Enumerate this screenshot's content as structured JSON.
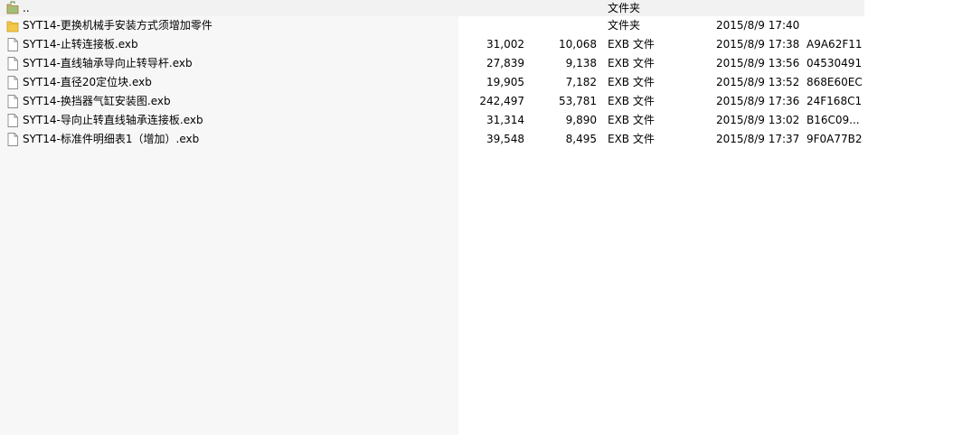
{
  "parent_row": {
    "name": "..",
    "type": "文件夹",
    "icon": "folder-up-icon"
  },
  "rows": [
    {
      "name": "SYT14-更换机械手安装方式须增加零件",
      "size": "",
      "packed": "",
      "type": "文件夹",
      "modified": "2015/8/9 17:40",
      "crc": "",
      "icon": "folder-icon"
    },
    {
      "name": "SYT14-止转连接板.exb",
      "size": "31,002",
      "packed": "10,068",
      "type": "EXB 文件",
      "modified": "2015/8/9 17:38",
      "crc": "A9A62F11",
      "icon": "file-icon"
    },
    {
      "name": "SYT14-直线轴承导向止转导杆.exb",
      "size": "27,839",
      "packed": "9,138",
      "type": "EXB 文件",
      "modified": "2015/8/9 13:56",
      "crc": "04530491",
      "icon": "file-icon"
    },
    {
      "name": "SYT14-直径20定位块.exb",
      "size": "19,905",
      "packed": "7,182",
      "type": "EXB 文件",
      "modified": "2015/8/9 13:52",
      "crc": "868E60EC",
      "icon": "file-icon"
    },
    {
      "name": "SYT14-换挡器气缸安装图.exb",
      "size": "242,497",
      "packed": "53,781",
      "type": "EXB 文件",
      "modified": "2015/8/9 17:36",
      "crc": "24F168C1",
      "icon": "file-icon"
    },
    {
      "name": "SYT14-导向止转直线轴承连接板.exb",
      "size": "31,314",
      "packed": "9,890",
      "type": "EXB 文件",
      "modified": "2015/8/9 13:02",
      "crc": "B16C09...",
      "icon": "file-icon"
    },
    {
      "name": "SYT14-标准件明细表1（增加）.exb",
      "size": "39,548",
      "packed": "8,495",
      "type": "EXB 文件",
      "modified": "2015/8/9 17:37",
      "crc": "9F0A77B2",
      "icon": "file-icon"
    }
  ],
  "colors": {
    "name_column_bg": "#f7f7f7",
    "top_row_bg": "#f2f2f2",
    "folder_yellow": "#f2c94c"
  }
}
